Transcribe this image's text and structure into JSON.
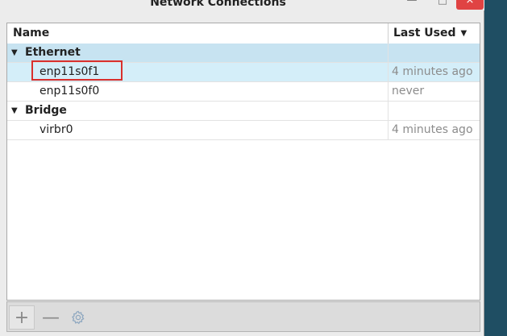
{
  "window": {
    "title": "Network Connections"
  },
  "window_controls": {
    "minimize": "—",
    "maximize": "□",
    "close": "×"
  },
  "table": {
    "columns": {
      "name": "Name",
      "last_used": "Last Used"
    },
    "groups": [
      {
        "label": "Ethernet",
        "items": [
          {
            "name": "enp11s0f1",
            "last_used": "4 minutes ago",
            "selected": true,
            "highlighted": true
          },
          {
            "name": "enp11s0f0",
            "last_used": "never"
          }
        ]
      },
      {
        "label": "Bridge",
        "items": [
          {
            "name": "virbr0",
            "last_used": "4 minutes ago"
          }
        ]
      }
    ]
  },
  "toolbar": {
    "add": "+",
    "remove": "—",
    "settings_icon": "gear-icon"
  },
  "colors": {
    "selection": "#d4eef9",
    "group_highlight": "#c7e3f1",
    "annotation": "#d9302d",
    "close_button": "#e04343"
  }
}
